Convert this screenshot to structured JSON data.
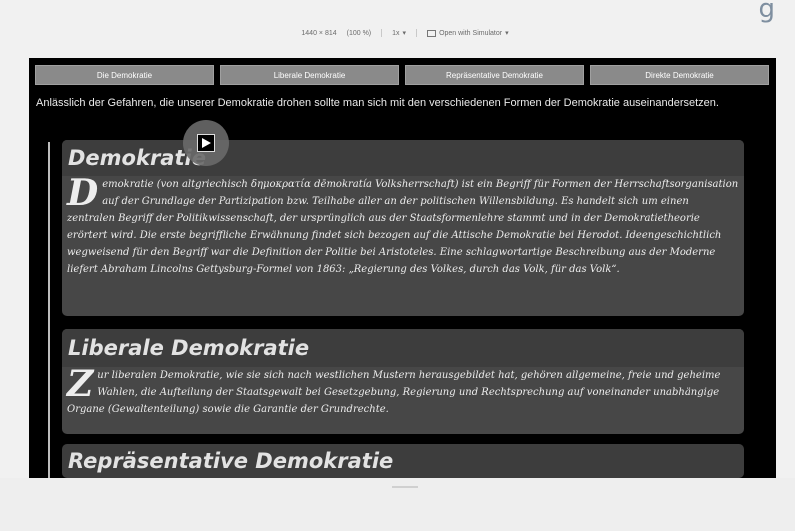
{
  "devbar": {
    "dimensions": "1440 × 814",
    "zoom": "(100 %)",
    "dpr": "1x",
    "open_sim": "Open with Simulator"
  },
  "top_glyph": "g",
  "nav": {
    "tabs": [
      "Die Demokratie",
      "Liberale Demokratie",
      "Repräsentative Demokratie",
      "Direkte Demokratie"
    ]
  },
  "intro": "Anlässlich der Gefahren, die unserer Demokratie drohen sollte man sich mit den verschiedenen Formen der Demokratie auseinandersetzen.",
  "sections": [
    {
      "title": "Demokratie",
      "dropcap": "D",
      "text": "emokratie (von altgriechisch δημοκρατία dēmokratía Volksherrschaft) ist ein Begriff für Formen der Herrschaftsorganisation auf der Grundlage der Partizipation bzw. Teilhabe aller an der politischen Willensbildung. Es handelt sich um einen zentralen Begriff der Politikwissenschaft, der ursprünglich aus der Staatsformenlehre stammt und in der Demokratietheorie erörtert wird. Die erste begriffliche Erwähnung findet sich bezogen auf die Attische Demokratie bei Herodot. Ideengeschichtlich wegweisend für den Begriff war die Definition der Politie bei Aristoteles. Eine schlagwortartige Beschreibung aus der Moderne liefert Abraham Lincolns Gettysburg-Formel von 1863: „Regierung des Volkes, durch das Volk, für das Volk“."
    },
    {
      "title": "Liberale Demokratie",
      "dropcap": "Z",
      "text": "ur liberalen Demokratie, wie sie sich nach westlichen Mustern herausgebildet hat, gehören allgemeine, freie und geheime Wahlen, die Aufteilung der Staatsgewalt bei Gesetzgebung, Regierung und Rechtsprechung auf voneinander unabhängige Organe (Gewaltenteilung) sowie die Garantie der Grundrechte."
    },
    {
      "title": "Repräsentative Demokratie"
    }
  ]
}
